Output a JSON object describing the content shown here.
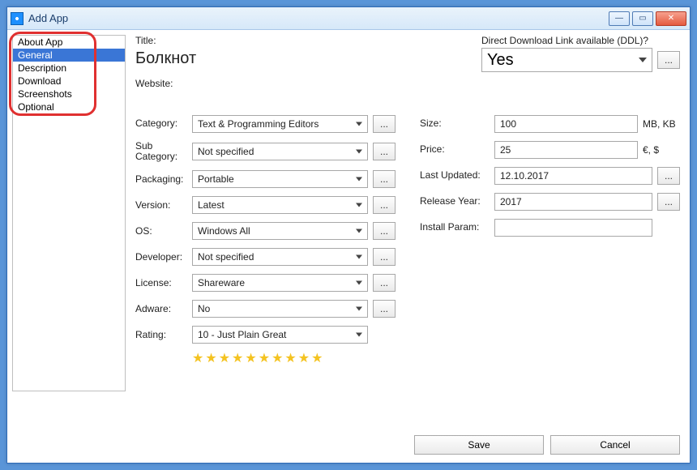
{
  "window": {
    "title": "Add App"
  },
  "sidebar": {
    "items": [
      "About App",
      "General",
      "Description",
      "Download",
      "Screenshots",
      "Optional"
    ],
    "selected_index": 1
  },
  "top": {
    "title_label": "Title:",
    "title_value": "Болкнот",
    "website_label": "Website:",
    "ddl_label": "Direct Download Link available (DDL)?",
    "ddl_value": "Yes"
  },
  "left_fields": {
    "category": {
      "label": "Category:",
      "value": "Text & Programming Editors"
    },
    "subcategory": {
      "label": "Sub Category:",
      "value": "Not specified"
    },
    "packaging": {
      "label": "Packaging:",
      "value": "Portable"
    },
    "version": {
      "label": "Version:",
      "value": "Latest"
    },
    "os": {
      "label": "OS:",
      "value": "Windows All"
    },
    "developer": {
      "label": "Developer:",
      "value": "Not specified"
    },
    "license": {
      "label": "License:",
      "value": "Shareware"
    },
    "adware": {
      "label": "Adware:",
      "value": "No"
    },
    "rating": {
      "label": "Rating:",
      "value": "10 - Just Plain Great"
    }
  },
  "right_fields": {
    "size": {
      "label": "Size:",
      "value": "100",
      "unit": "MB, KB"
    },
    "price": {
      "label": "Price:",
      "value": "25",
      "unit": "€, $"
    },
    "last_updated": {
      "label": "Last Updated:",
      "value": "12.10.2017"
    },
    "release_year": {
      "label": "Release Year:",
      "value": "2017"
    },
    "install_param": {
      "label": "Install Param:",
      "value": ""
    }
  },
  "buttons": {
    "ellipsis": "...",
    "save": "Save",
    "cancel": "Cancel"
  },
  "stars": "★★★★★★★★★★"
}
